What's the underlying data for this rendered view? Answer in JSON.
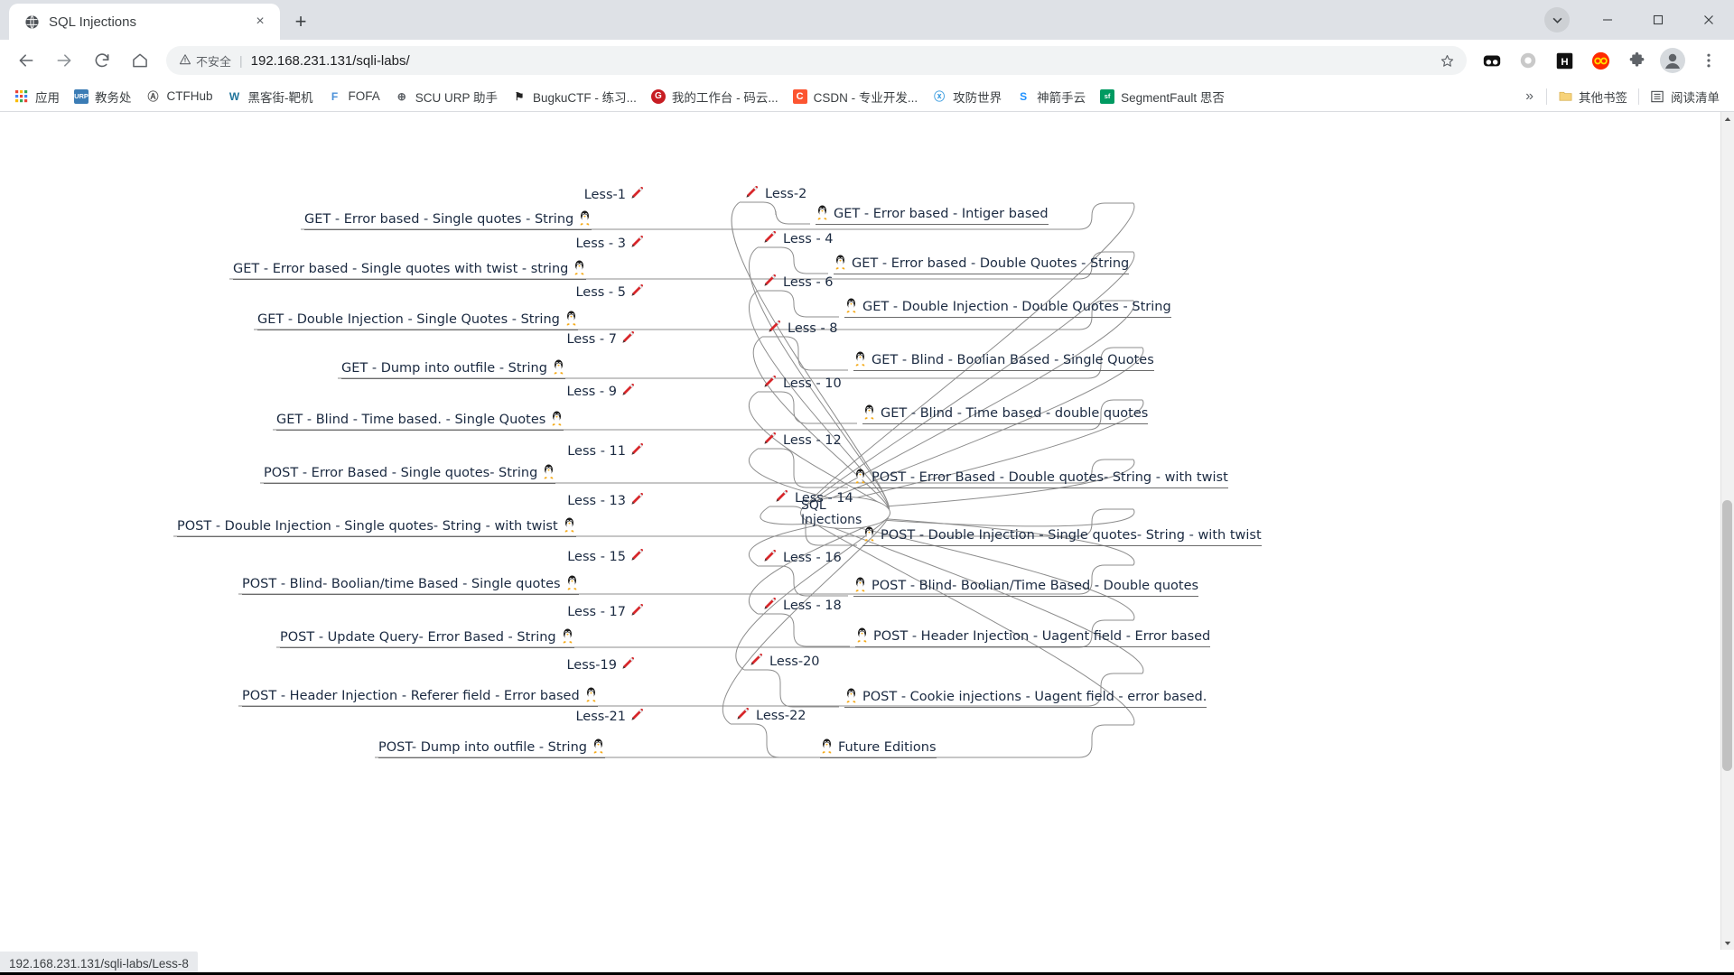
{
  "window": {
    "tab": {
      "title": "SQL Injections",
      "favicon": "globe-icon",
      "close_label": "×"
    },
    "newtab_label": "+",
    "controls": {
      "minimize": "—",
      "maximize": "☐",
      "close": "✕",
      "chevron": "▾"
    }
  },
  "toolbar": {
    "back": "←",
    "forward": "→",
    "reload": "⟳",
    "home": "⌂",
    "security_text": "不安全",
    "separator": "|",
    "url": "192.168.231.131/sqli-labs/",
    "star": "☆",
    "extensions": [
      {
        "name": "binoculars-extension-icon",
        "glyph": "●●",
        "color": "#1a1a1a"
      },
      {
        "name": "circle-extension-icon",
        "glyph": "○",
        "color": "#bdbdbd"
      },
      {
        "name": "h-extension-icon",
        "glyph": "H",
        "color": "#111111"
      },
      {
        "name": "infinity-extension-icon",
        "glyph": "∞",
        "color": "#ff2a00"
      },
      {
        "name": "puzzle-extensions-icon",
        "glyph": "❖",
        "color": "#5f6368"
      },
      {
        "name": "profile-avatar-icon",
        "glyph": "👤",
        "color": "#5f6368"
      },
      {
        "name": "more-menu-icon",
        "glyph": "⋮",
        "color": "#5f6368"
      }
    ]
  },
  "bookmarks": {
    "items": [
      {
        "label": "应用",
        "icon": "apps-grid-icon",
        "icon_glyph": "☰",
        "icon_color": "#4285f4"
      },
      {
        "label": "教务处",
        "icon": "urp-icon",
        "icon_glyph": "URP",
        "icon_color": "#3b7cb5"
      },
      {
        "label": "CTFHub",
        "icon": "ctfhub-icon",
        "icon_glyph": "Ⓐ",
        "icon_color": "#555555"
      },
      {
        "label": "黑客街-靶机",
        "icon": "wordpress-icon",
        "icon_glyph": "W",
        "icon_color": "#21759b"
      },
      {
        "label": "FOFA",
        "icon": "fofa-icon",
        "icon_glyph": "F",
        "icon_color": "#4a90d9"
      },
      {
        "label": "SCU URP 助手",
        "icon": "globe-icon",
        "icon_glyph": "⊕",
        "icon_color": "#5f6368"
      },
      {
        "label": "BugkuCTF - 练习...",
        "icon": "flag-icon",
        "icon_glyph": "⚑",
        "icon_color": "#222222"
      },
      {
        "label": "我的工作台 - 码云...",
        "icon": "gitee-icon",
        "icon_glyph": "G",
        "icon_color": "#c71d23"
      },
      {
        "label": "CSDN - 专业开发...",
        "icon": "csdn-icon",
        "icon_glyph": "C",
        "icon_color": "#fc5531"
      },
      {
        "label": "攻防世界",
        "icon": "xctf-icon",
        "icon_glyph": "ⓧ",
        "icon_color": "#3f9ee0"
      },
      {
        "label": "神箭手云",
        "icon": "shenjian-icon",
        "icon_glyph": "S",
        "icon_color": "#1e90ff"
      },
      {
        "label": "SegmentFault 思否",
        "icon": "segmentfault-icon",
        "icon_glyph": "sf",
        "icon_color": "#009a61"
      }
    ],
    "overflow_label": "»",
    "other_bookmarks": {
      "label": "其他书签",
      "icon": "folder-icon",
      "icon_glyph": "📁"
    },
    "reading_list": {
      "label": "阅读清单",
      "icon": "reading-list-icon",
      "icon_glyph": "☰"
    }
  },
  "mindmap": {
    "root": "SQL Injections",
    "pen_icon": "🖍",
    "tux_icon": "🐧",
    "left": [
      {
        "branch": "Less-1",
        "label": "GET - Error based - Single quotes - String"
      },
      {
        "branch": "Less - 3",
        "label": "GET - Error based - Single quotes with twist - string"
      },
      {
        "branch": "Less - 5",
        "label": "GET - Double Injection - Single Quotes - String"
      },
      {
        "branch": "Less - 7",
        "label": "GET - Dump into outfile - String"
      },
      {
        "branch": "Less - 9",
        "label": "GET - Blind - Time based. -  Single Quotes"
      },
      {
        "branch": "Less - 11",
        "label": "POST - Error Based - Single quotes- String"
      },
      {
        "branch": "Less - 13",
        "label": "POST - Double Injection - Single quotes- String - with twist"
      },
      {
        "branch": "Less - 15",
        "label": "POST - Blind- Boolian/time Based - Single quotes"
      },
      {
        "branch": "Less - 17",
        "label": "POST - Update Query- Error Based - String"
      },
      {
        "branch": "Less-19",
        "label": "POST - Header Injection - Referer field - Error based"
      },
      {
        "branch": "Less-21",
        "label": "POST- Dump into outfile - String"
      }
    ],
    "right": [
      {
        "branch": "Less-2",
        "label": "GET - Error based - Intiger based"
      },
      {
        "branch": "Less - 4",
        "label": "GET - Error based - Double Quotes - String"
      },
      {
        "branch": "Less - 6",
        "label": "GET - Double Injection - Double Quotes - String"
      },
      {
        "branch": "Less - 8",
        "label": "GET - Blind - Boolian Based - Single Quotes"
      },
      {
        "branch": "Less - 10",
        "label": "GET - Blind - Time based - double quotes"
      },
      {
        "branch": "Less - 12",
        "label": "POST - Error Based - Double quotes- String - with twist"
      },
      {
        "branch": "Less - 14",
        "label": "POST - Double Injection - Single quotes- String - with twist"
      },
      {
        "branch": "Less - 16",
        "label": "POST - Blind- Boolian/Time Based - Double quotes"
      },
      {
        "branch": "Less - 18",
        "label": "POST - Header Injection - Uagent field - Error based"
      },
      {
        "branch": "Less-20",
        "label": "POST - Cookie injections - Uagent field - error based."
      },
      {
        "branch": "Less-22",
        "label": "Future Editions"
      }
    ]
  },
  "statusbar": {
    "url": "192.168.231.131/sqli-labs/Less-8"
  },
  "colors": {
    "tabstrip_bg": "#dee1e6",
    "omnibox_bg": "#f1f3f4",
    "text": "#3c4043",
    "accent": "#4285f4",
    "pen_red": "#d62a22"
  }
}
